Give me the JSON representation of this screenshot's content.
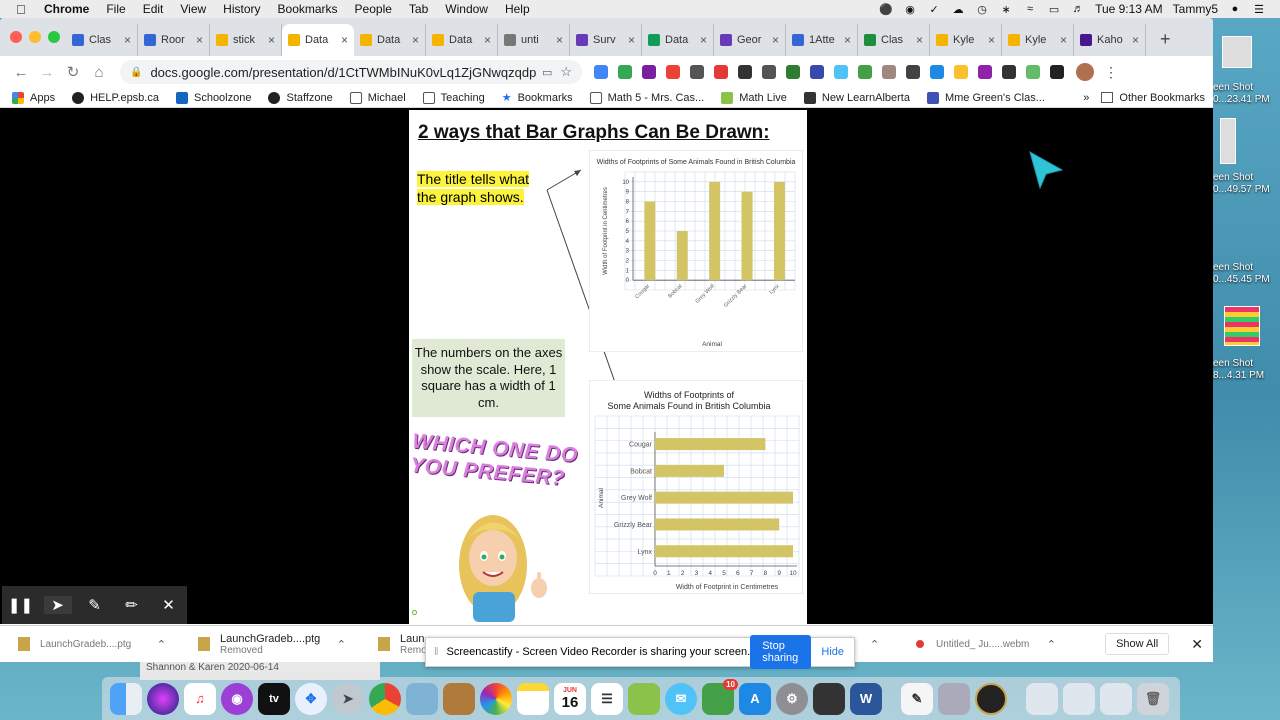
{
  "menubar": {
    "app": "Chrome",
    "items": [
      "File",
      "Edit",
      "View",
      "History",
      "Bookmarks",
      "People",
      "Tab",
      "Window",
      "Help"
    ],
    "clock": "Tue 9:13 AM",
    "user": "Tammy5"
  },
  "tabs": [
    {
      "label": "Clas",
      "color": "#3367d6"
    },
    {
      "label": "Roor",
      "color": "#3367d6"
    },
    {
      "label": "stick",
      "color": "#f4b400"
    },
    {
      "label": "Data",
      "color": "#f4b400",
      "active": true
    },
    {
      "label": "Data",
      "color": "#f4b400"
    },
    {
      "label": "Data",
      "color": "#f4b400"
    },
    {
      "label": "unti",
      "color": "#777777"
    },
    {
      "label": "Surv",
      "color": "#673ab7"
    },
    {
      "label": "Data",
      "color": "#0f9d58"
    },
    {
      "label": "Geor",
      "color": "#673ab7"
    },
    {
      "label": "1Atte",
      "color": "#3367d6"
    },
    {
      "label": "Clas",
      "color": "#1e8e3e"
    },
    {
      "label": "Kyle",
      "color": "#f4b400"
    },
    {
      "label": "Kyle",
      "color": "#f4b400"
    },
    {
      "label": "Kaho",
      "color": "#46178f"
    }
  ],
  "omnibox": {
    "url": "docs.google.com/presentation/d/1CtTWMbINuK0vLq1ZjGNwqzqdp0IV..."
  },
  "bookmarks": {
    "items": [
      "Apps",
      "HELP.epsb.ca",
      "Schoolzone",
      "Staffzone",
      "Michael",
      "Teaching",
      "Bookmarks",
      "Math 5 - Mrs. Cas...",
      "Math Live",
      "New LearnAlberta",
      "Mme Green's Clas..."
    ],
    "overflow": "»",
    "other": "Other Bookmarks"
  },
  "slide": {
    "title": "2 ways that Bar Graphs Can Be Drawn:",
    "note_title": "The title tells what the graph shows.",
    "note_scale": "The numbers on the axes show the scale. Here, 1 square has a width of 1 cm.",
    "prefer": "WHICH ONE DO YOU PREFER?"
  },
  "chart_data": [
    {
      "type": "bar",
      "orientation": "vertical",
      "title": "Widths of Footprints of Some Animals Found in British Columbia",
      "categories": [
        "Cougar",
        "Bobcat",
        "Grey Wolf",
        "Grizzly Bear",
        "Lynx"
      ],
      "values": [
        8,
        5,
        10,
        9,
        10
      ],
      "xlabel": "Animal",
      "ylabel": "Width of Footprint in Centimetres",
      "ylim": [
        0,
        10
      ],
      "yticks": [
        "0",
        "1",
        "2",
        "3",
        "4",
        "5",
        "6",
        "7",
        "8",
        "9",
        "10"
      ],
      "grid": true,
      "bar_color": "#d3c466"
    },
    {
      "type": "bar",
      "orientation": "horizontal",
      "title": "Widths of Footprints of Some Animals Found in British Columbia",
      "categories": [
        "Cougar",
        "Bobcat",
        "Grey Wolf",
        "Grizzly Bear",
        "Lynx"
      ],
      "values": [
        8,
        5,
        10,
        9,
        10
      ],
      "xlabel": "Width of Footprint in Centimetres",
      "ylabel": "Animal",
      "xlim": [
        0,
        10
      ],
      "xticks": [
        "0",
        "1",
        "2",
        "3",
        "4",
        "5",
        "6",
        "7",
        "8",
        "9",
        "10"
      ],
      "grid": true,
      "bar_color": "#d3c466"
    }
  ],
  "downloads": {
    "items": [
      {
        "name": "LaunchGradeb....ptg",
        "status": ""
      },
      {
        "name": "LaunchGradeb....ptg",
        "status": "Removed"
      },
      {
        "name": "Laun",
        "status": "Remo"
      },
      {
        "name": "Untitled_ Ju.....webm",
        "status": ""
      }
    ],
    "show_all": "Show All"
  },
  "sharebar": {
    "message": "Screencastify - Screen Video Recorder is sharing your screen.",
    "stop": "Stop sharing",
    "hide": "Hide"
  },
  "behind_window": {
    "line1": "Shannon & Karen   2020-06-14",
    "line2": "So glad we were able to get each"
  },
  "desktop_files": [
    {
      "line1": "een Shot",
      "line2": "0...23.41 PM"
    },
    {
      "line1": "een Shot",
      "line2": "0...49.57 PM"
    },
    {
      "line1": "een Shot",
      "line2": "0...45.45 PM"
    },
    {
      "line1": "een Shot",
      "line2": "8...4.31 PM"
    }
  ],
  "dock": {
    "calendar_day": "16",
    "calendar_month": "JUN",
    "mail_badge": "10"
  }
}
